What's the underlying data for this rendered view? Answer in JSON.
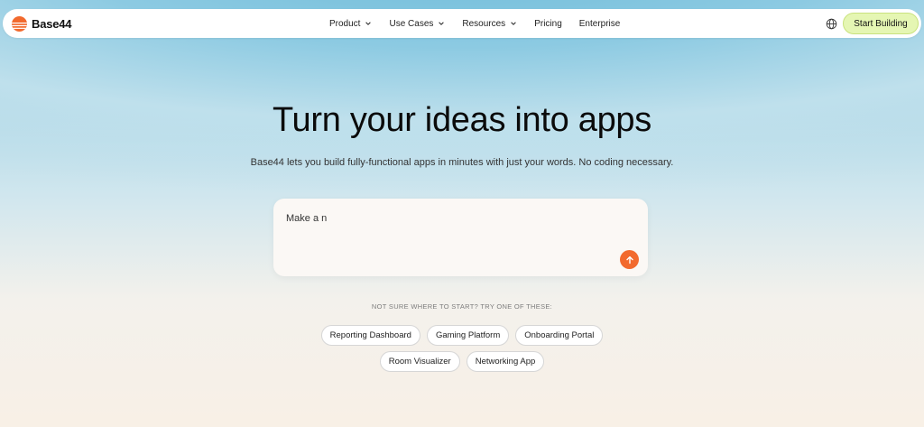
{
  "brand": {
    "name": "Base44",
    "accent_color": "#f26a2e"
  },
  "nav": {
    "items": [
      {
        "label": "Product",
        "has_dropdown": true
      },
      {
        "label": "Use Cases",
        "has_dropdown": true
      },
      {
        "label": "Resources",
        "has_dropdown": true
      },
      {
        "label": "Pricing",
        "has_dropdown": false
      },
      {
        "label": "Enterprise",
        "has_dropdown": false
      }
    ],
    "language_icon": "globe-icon",
    "cta_label": "Start Building",
    "cta_color": "#e5f6b3"
  },
  "hero": {
    "title": "Turn your ideas into apps",
    "subtitle": "Base44 lets you build fully-functional apps in minutes with just your words. No coding necessary."
  },
  "prompt": {
    "value": "Make a n",
    "send_icon": "arrow-up-icon"
  },
  "suggestions": {
    "label": "NOT SURE WHERE TO START? TRY ONE OF THESE:",
    "row1": [
      "Reporting Dashboard",
      "Gaming Platform",
      "Onboarding Portal"
    ],
    "row2": [
      "Room Visualizer",
      "Networking App"
    ]
  }
}
